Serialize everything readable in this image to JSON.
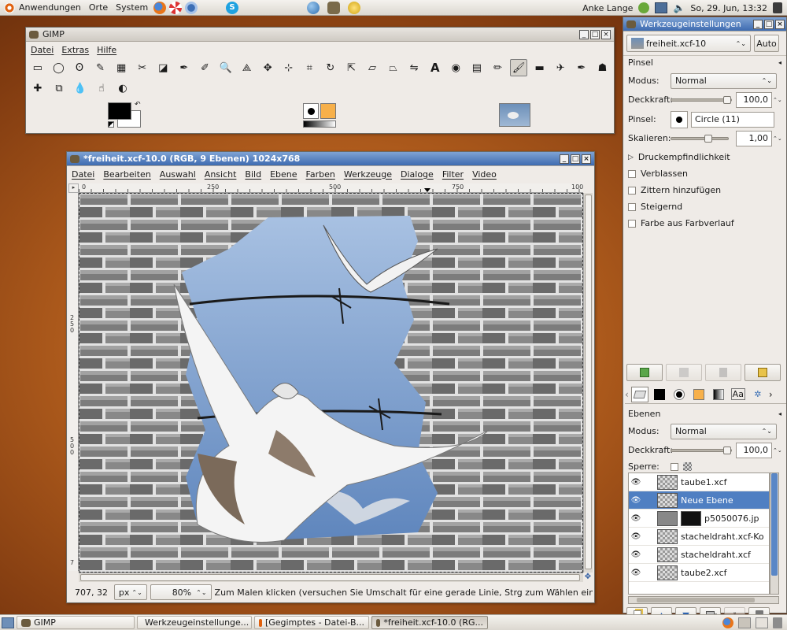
{
  "top_panel": {
    "menus": [
      "Anwendungen",
      "Orte",
      "System"
    ],
    "user": "Anke Lange",
    "datetime": "So, 29. Jun, 13:32"
  },
  "toolbox": {
    "title": "GIMP",
    "menu": [
      "Datei",
      "Extras",
      "Hilfe"
    ],
    "tools_row1": [
      "rect-select",
      "ellipse-select",
      "free-select",
      "fuzzy-select",
      "color-select",
      "scissors",
      "foreground-select",
      "paths",
      "color-picker",
      "zoom",
      "measure",
      "move",
      "align",
      "crop",
      "rotate",
      "scale",
      "shear",
      "perspective",
      "flip",
      "text",
      "bucket-fill",
      "blend",
      "pencil",
      "paintbrush",
      "eraser",
      "airbrush",
      "ink",
      "clone"
    ],
    "tools_row2": [
      "heal",
      "perspective-clone",
      "blur",
      "smudge",
      "dodge-burn"
    ]
  },
  "image_window": {
    "title": "*freiheit.xcf-10.0 (RGB, 9 Ebenen) 1024x768",
    "menu": [
      "Datei",
      "Bearbeiten",
      "Auswahl",
      "Ansicht",
      "Bild",
      "Ebene",
      "Farben",
      "Werkzeuge",
      "Dialoge",
      "Filter",
      "Video"
    ],
    "ruler_h": [
      "0",
      "250",
      "500",
      "750",
      "100"
    ],
    "ruler_v": [
      "2\n5\n0",
      "5\n0\n0",
      "7"
    ],
    "coords": "707, 32",
    "unit": "px",
    "zoom": "80%",
    "status": "Zum Malen klicken (versuchen Sie Umschalt für eine gerade Linie, Strg zum Wählen einer Farbe)"
  },
  "dock": {
    "title": "Werkzeugeinstellungen",
    "image_select": "freiheit.xcf-10",
    "auto": "Auto",
    "tool_name": "Pinsel",
    "modus_label": "Modus:",
    "modus_value": "Normal",
    "deckkraft_label": "Deckkraft:",
    "deckkraft_value": "100,0",
    "pinsel_label": "Pinsel:",
    "pinsel_value": "Circle (11)",
    "skalieren_label": "Skalieren:",
    "skalieren_value": "1,00",
    "druck": "Druckempfindlichkeit",
    "options": [
      "Verblassen",
      "Zittern hinzufügen",
      "Steigernd",
      "Farbe aus Farbverlauf"
    ],
    "layers_title": "Ebenen",
    "layers_modus_value": "Normal",
    "layers_deckkraft_value": "100,0",
    "sperre_label": "Sperre:",
    "layers": [
      {
        "name": "taube1.xcf",
        "selected": false
      },
      {
        "name": "Neue Ebene",
        "selected": true
      },
      {
        "name": "p5050076.jp",
        "selected": false
      },
      {
        "name": "stacheldraht.xcf-Ko",
        "selected": false
      },
      {
        "name": "stacheldraht.xcf",
        "selected": false
      },
      {
        "name": "taube2.xcf",
        "selected": false
      }
    ]
  },
  "taskbar": {
    "items": [
      "GIMP",
      "Werkzeugeinstellunge...",
      "[Gegimptes - Datei-B...",
      "*freiheit.xcf-10.0 (RG..."
    ]
  },
  "colors": {
    "selection": "#4f7fc2",
    "title_active": "#3e6bb0",
    "fg": "#000000",
    "bg": "#ffffff",
    "brick": "#8a8a8a",
    "sky": "#8fb0d8"
  }
}
